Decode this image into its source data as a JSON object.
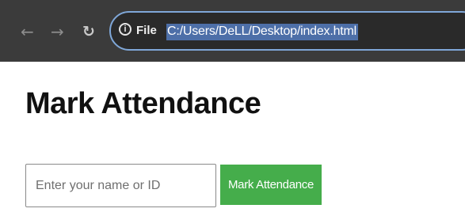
{
  "browser": {
    "back_icon": "back-arrow-icon",
    "forward_icon": "forward-arrow-icon",
    "reload_icon": "reload-icon",
    "site_info_icon": "info-icon",
    "scheme_label": "File",
    "url": "C:/Users/DeLL/Desktop/index.html",
    "accent_color": "#7fa7d8",
    "selection_color": "#4d6fa8"
  },
  "page": {
    "title": "Mark Attendance",
    "input_placeholder": "Enter your name or ID",
    "input_value": "",
    "button_label": "Mark Attendance",
    "button_color": "#45ad4b"
  }
}
